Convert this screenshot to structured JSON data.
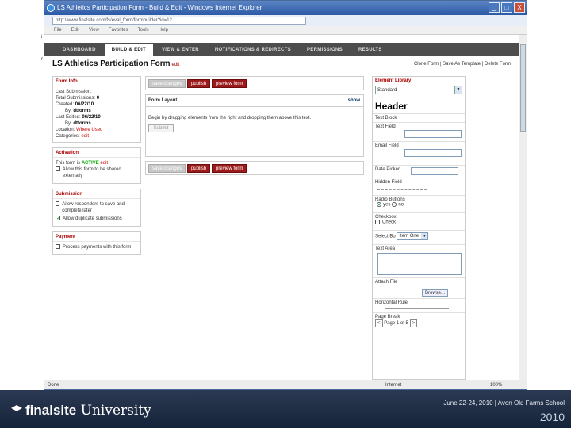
{
  "window": {
    "title": "LS Athletics Participation Form - Build & Edit - Windows Internet Explorer",
    "address": "http://www.finalsite.com/fs/eval_form/formbuilder?id=12",
    "controls": [
      "_",
      "□",
      "X"
    ]
  },
  "menubar": [
    "File",
    "Edit",
    "View",
    "Favorites",
    "Tools",
    "Help"
  ],
  "tabs": [
    "DASHBOARD",
    "BUILD & EDIT",
    "VIEW & ENTER",
    "NOTIFICATIONS & REDIRECTS",
    "PERMISSIONS",
    "RESULTS"
  ],
  "form": {
    "title": "LS Athletics Participation Form",
    "title_edit": "edit",
    "actions": "Clone Form | Save As Template | Delete Form"
  },
  "form_info": {
    "header": "Form Info",
    "last_submission": "Last Submission:",
    "total_label": "Total Submissions:",
    "total_value": "0",
    "created_label": "Created:",
    "created_value": "06/22/10",
    "created_by_label": "By:",
    "created_by_value": "dtforms",
    "edited_label": "Last Edited:",
    "edited_value": "06/22/10",
    "edited_by_label": "By:",
    "edited_by_value": "dtforms",
    "location_label": "Location:",
    "location_value": "Where Used",
    "categories_label": "Categories:",
    "categories_value": "edit"
  },
  "activation": {
    "header": "Activation",
    "status_prefix": "This form is",
    "status": "ACTIVE",
    "edit": "edit",
    "share_label": "Allow this form to be shared externally"
  },
  "submission": {
    "header": "Submission",
    "opt1": "Allow responders to save and complete later",
    "opt2": "Allow duplicate submissions"
  },
  "payment": {
    "header": "Payment",
    "opt1": "Process payments with this form"
  },
  "buttons": {
    "save": "save changes",
    "publish": "publish",
    "preview": "preview form"
  },
  "layout": {
    "header": "Form Layout",
    "show": "show",
    "body": "Begin by dragging elements from the right and dropping them above this text.",
    "submit": "Submit"
  },
  "library": {
    "header": "Element Library",
    "selected": "Standard",
    "header_item": "Header",
    "text_block": "Text Block",
    "text_field": "Text Field",
    "email_field": "Email Field",
    "date_picker": "Date Picker",
    "hidden_field": "Hidden Field",
    "radio_buttons": "Radio Buttons",
    "radio_yes": "yes",
    "radio_no": "no",
    "checkbox": "Checkbox",
    "checkbox_option": "Check",
    "select_box": "Select Bo",
    "select_value": "Item One",
    "text_area": "Text Area",
    "attach_file": "Attach File",
    "browse": "Browse...",
    "horizontal_rule": "Horizontal Rule",
    "page_break": "Page Break",
    "pager_text": "Page 1 of 5"
  },
  "statusbar": {
    "left": "Done",
    "zone": "Internet",
    "zoom": "100%"
  },
  "footer": {
    "brand_a": "finalsite",
    "brand_b": "University",
    "event": "June 22-24, 2010 | Avon Old Farms School",
    "year": "2010"
  },
  "edge_chars": [
    "i",
    "r",
    "."
  ]
}
